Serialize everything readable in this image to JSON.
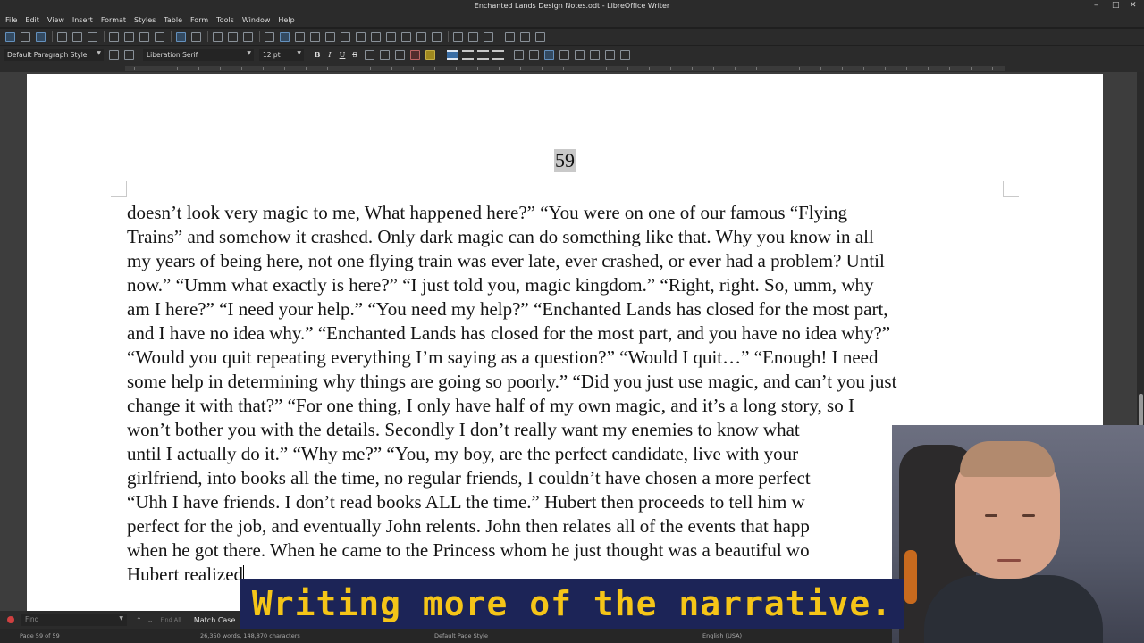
{
  "window": {
    "title": "Enchanted Lands Design Notes.odt - LibreOffice Writer",
    "controls": [
      "–",
      "□",
      "✕"
    ]
  },
  "menu": [
    "File",
    "Edit",
    "View",
    "Insert",
    "Format",
    "Styles",
    "Table",
    "Form",
    "Tools",
    "Window",
    "Help"
  ],
  "formatting": {
    "paragraph_style": "Default Paragraph Style",
    "font_name": "Liberation Serif",
    "font_size": "12 pt",
    "bold": "B",
    "italic": "I",
    "underline": "U",
    "strikethrough": "S"
  },
  "document": {
    "page_number": "59",
    "lines": [
      "doesn’t look very magic to me, What happened here?”  “You were on one of our famous “Flying",
      "Trains” and somehow it crashed.  Only dark magic can do something like that.  Why you know in all",
      "my years of being here, not one flying train was ever late, ever crashed, or ever had a problem? Until",
      "now.”  “Umm what exactly is here?”  “I just told you, magic kingdom.”  “Right, right.  So, umm, why",
      "am I here?”  “I need your help.” “You need my help?” “Enchanted Lands has closed for the most part,",
      "and I have no idea why.”  “Enchanted Lands has closed for the most part, and you have no idea why?”",
      "“Would you quit repeating everything I’m saying as a question?”  “Would I quit…” “Enough!  I need",
      "some help in determining why things are going so poorly.”  “Did you just use magic, and can’t you just",
      "change it with that?”  “For one thing, I only have half of my own magic, and it’s a long story, so I",
      "won’t bother you with the details.  Secondly I don’t really want my enemies to know what",
      "until I actually do it.”  “Why me?” “You, my boy, are the perfect candidate, live with your",
      "girlfriend, into books all the time, no regular friends, I couldn’t have chosen a more perfect",
      "“Uhh I have friends. I don’t read books ALL the time.”  Hubert then proceeds to tell him w",
      "perfect for the job, and eventually John relents.  John then relates all of the events that happ",
      "when he got there.  When he came to the Princess whom he just thought was a beautiful wo",
      "Hubert realized"
    ]
  },
  "findbar": {
    "placeholder": "Find",
    "find_all": "Find All",
    "match_case": "Match Case"
  },
  "status": {
    "page": "Page 59 of 59",
    "words": "26,350 words, 148,870 characters",
    "page_style": "Default Page Style",
    "language": "English (USA)"
  },
  "caption": "Writing more of the narrative."
}
